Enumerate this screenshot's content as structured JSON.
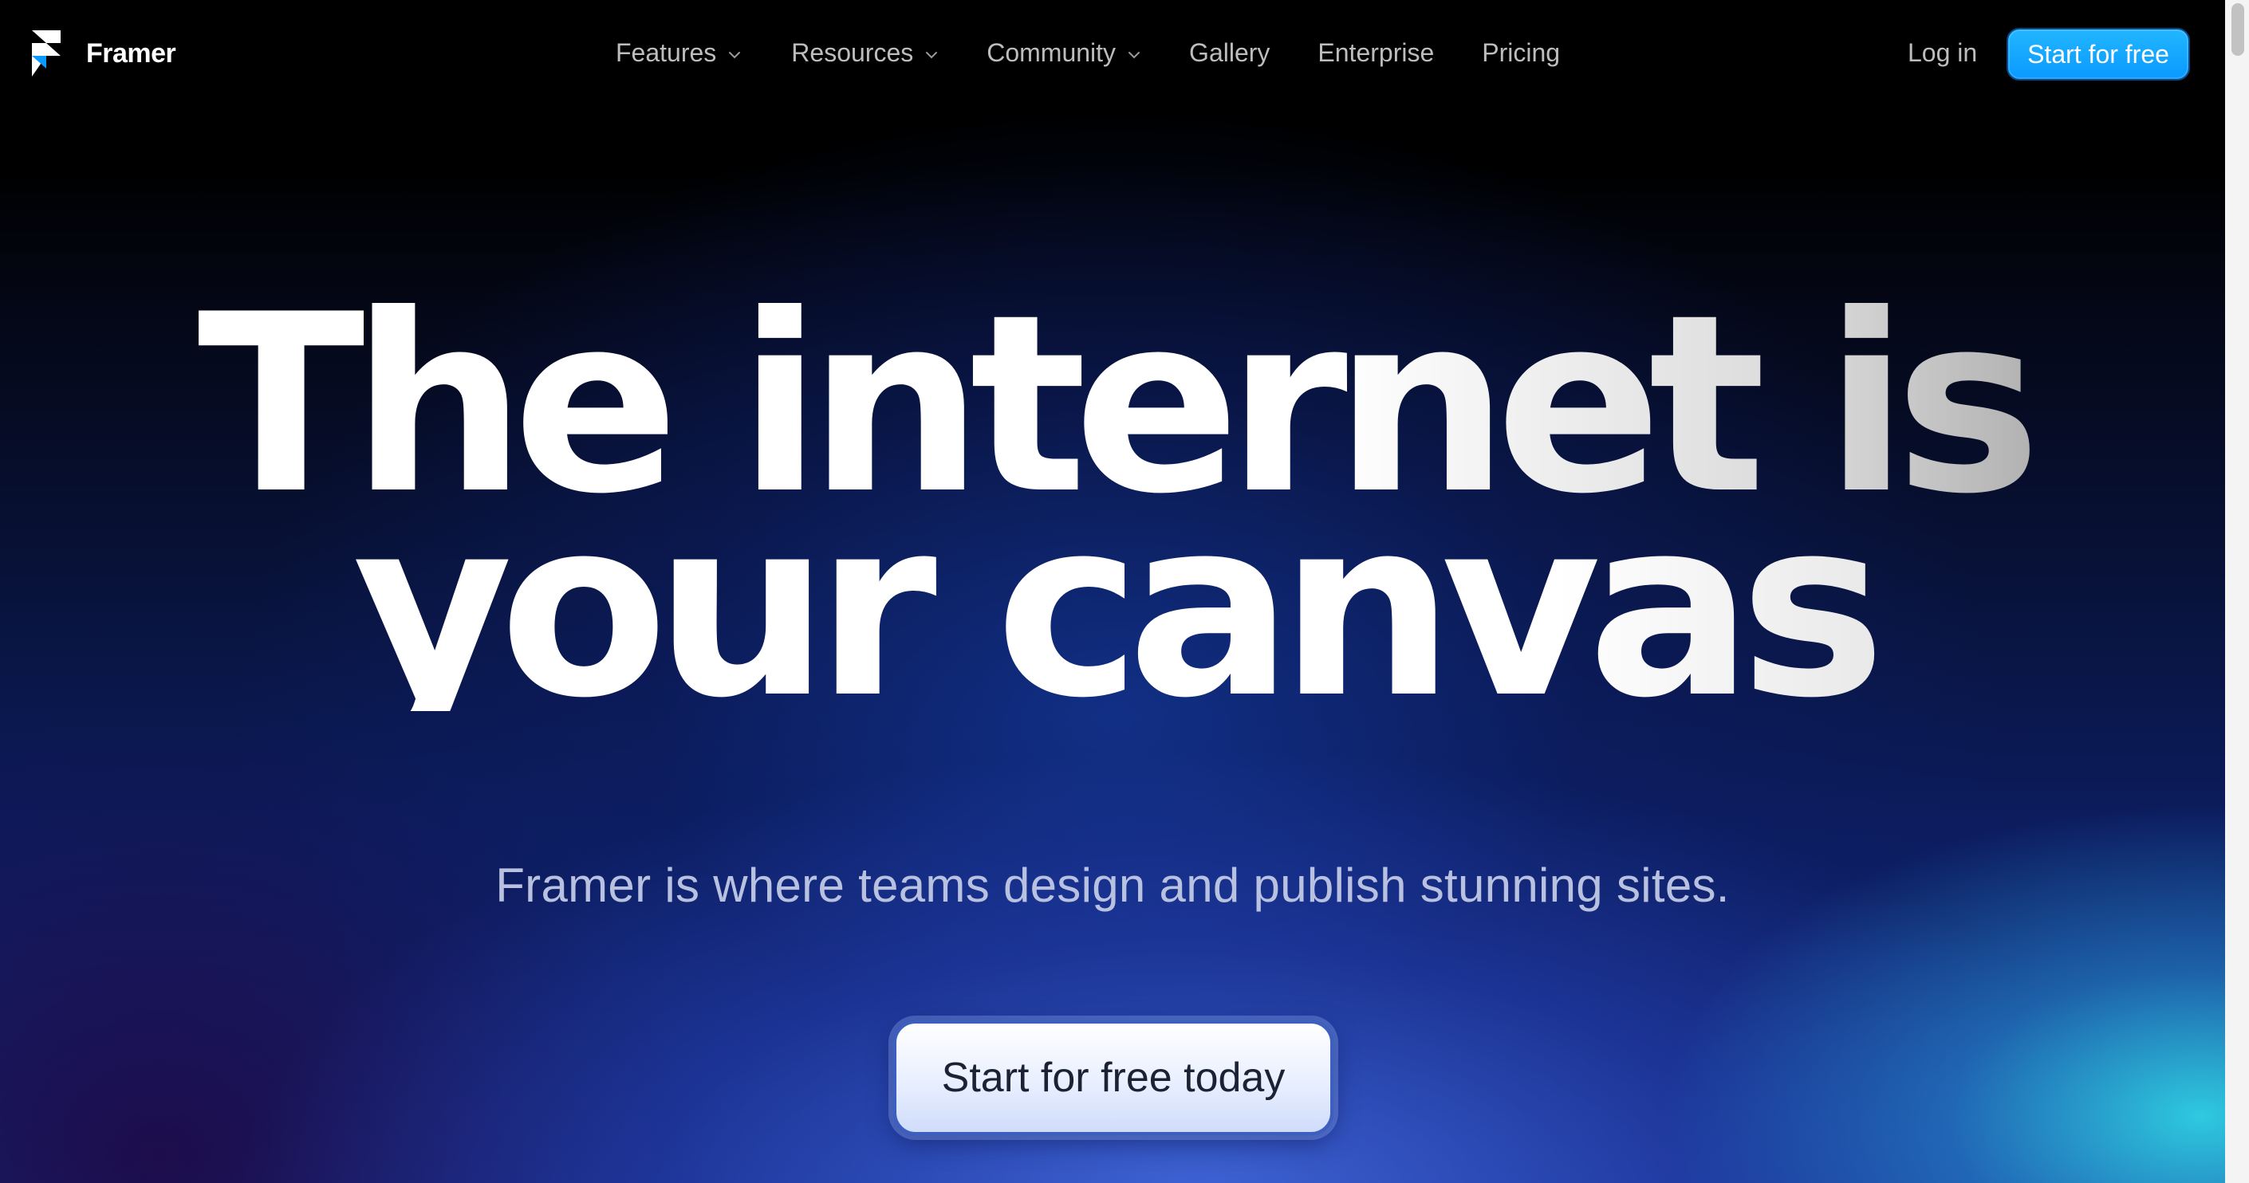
{
  "brand": {
    "name": "Framer",
    "accent_color": "#0A99FF"
  },
  "nav": {
    "items": [
      {
        "label": "Features",
        "has_dropdown": true
      },
      {
        "label": "Resources",
        "has_dropdown": true
      },
      {
        "label": "Community",
        "has_dropdown": true
      },
      {
        "label": "Gallery",
        "has_dropdown": false
      },
      {
        "label": "Enterprise",
        "has_dropdown": false
      },
      {
        "label": "Pricing",
        "has_dropdown": false
      }
    ],
    "login_label": "Log in",
    "cta_label": "Start for free"
  },
  "hero": {
    "title_line1": "The internet is",
    "title_line2": "your canvas",
    "subtitle": "Framer is where teams design and publish stunning sites.",
    "cta_label": "Start for free today"
  },
  "icons": {
    "logo": "framer-logo-icon",
    "dropdown": "chevron-down-icon"
  }
}
